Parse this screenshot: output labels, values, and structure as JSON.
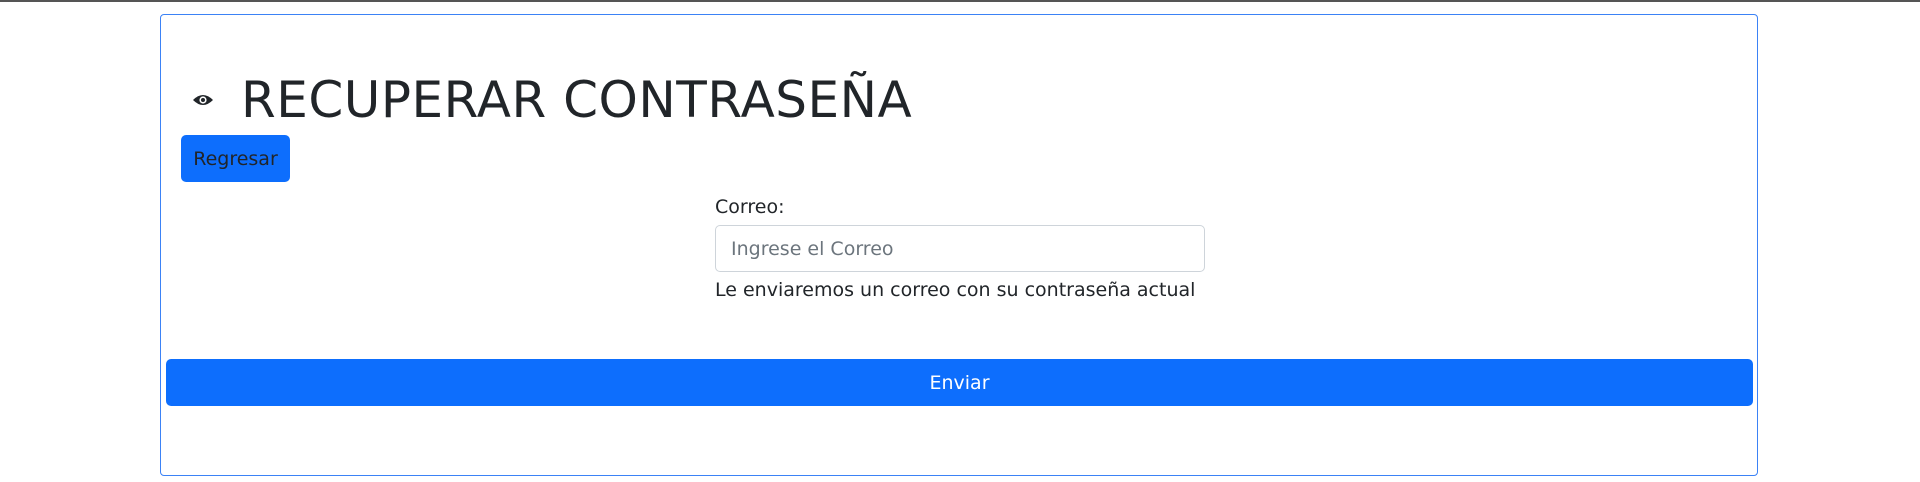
{
  "page": {
    "title": "RECUPERAR CONTRASEÑA",
    "title_icon": "eye-icon"
  },
  "actions": {
    "back_label": "Regresar",
    "submit_label": "Enviar"
  },
  "form": {
    "email_label": "Correo:",
    "email_placeholder": "Ingrese el Correo",
    "email_value": "",
    "help_text": "Le enviaremos un correo con su contraseña actual"
  },
  "colors": {
    "primary": "#0d6efd",
    "card_border": "#3b82f6",
    "text": "#212529",
    "placeholder": "#6c757d"
  }
}
